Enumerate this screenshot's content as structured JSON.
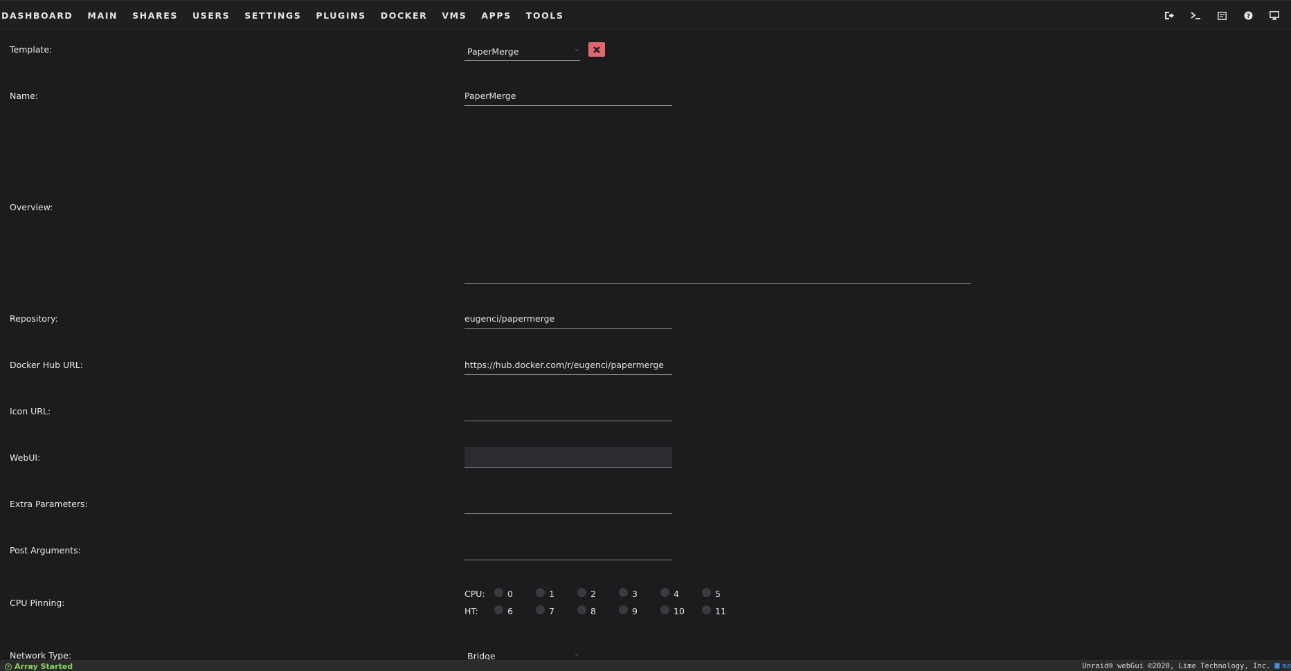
{
  "nav": {
    "items": [
      "DASHBOARD",
      "MAIN",
      "SHARES",
      "USERS",
      "SETTINGS",
      "PLUGINS",
      "DOCKER",
      "VMS",
      "APPS",
      "TOOLS"
    ],
    "active": "DOCKER"
  },
  "toolbar": {
    "icons": [
      "logout-icon",
      "terminal-icon",
      "log-icon",
      "help-icon",
      "display-icon"
    ]
  },
  "form": {
    "template": {
      "label": "Template:",
      "value": "PaperMerge"
    },
    "name": {
      "label": "Name:",
      "value": "PaperMerge"
    },
    "overview": {
      "label": "Overview:",
      "value": ""
    },
    "repository": {
      "label": "Repository:",
      "value": "eugenci/papermerge"
    },
    "docker_hub_url": {
      "label": "Docker Hub URL:",
      "value": "https://hub.docker.com/r/eugenci/papermerge"
    },
    "icon_url": {
      "label": "Icon URL:",
      "value": ""
    },
    "webui": {
      "label": "WebUI:",
      "value": ""
    },
    "extra_parameters": {
      "label": "Extra Parameters:",
      "value": ""
    },
    "post_arguments": {
      "label": "Post Arguments:",
      "value": ""
    },
    "cpu_pinning": {
      "label": "CPU Pinning:",
      "cpu_label": "CPU:",
      "ht_label": "HT:",
      "cpu": [
        "0",
        "1",
        "2",
        "3",
        "4",
        "5"
      ],
      "ht": [
        "6",
        "7",
        "8",
        "9",
        "10",
        "11"
      ]
    },
    "network_type": {
      "label": "Network Type:",
      "value": "Bridge"
    }
  },
  "status": {
    "array": "Array Started",
    "copyright": "Unraid® webGui ©2020, Lime Technology, Inc.",
    "link": "ma"
  },
  "colors": {
    "background": "#1c1c1e",
    "remove_button": "#e0676f",
    "status_ok": "#8bd45b"
  }
}
